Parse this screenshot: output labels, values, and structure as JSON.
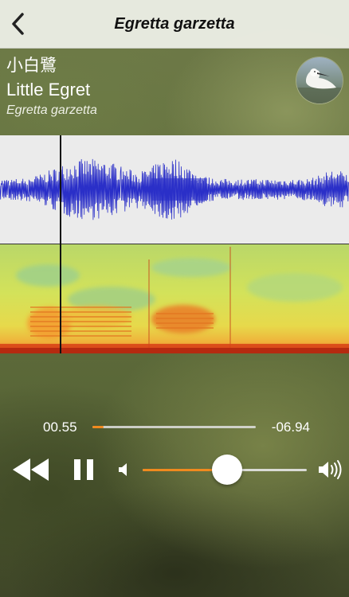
{
  "navbar": {
    "title": "Egretta garzetta",
    "back_icon": "chevron-left-icon"
  },
  "species": {
    "chinese_name": "小白鷺",
    "common_name": "Little Egret",
    "latin_name": "Egretta garzetta",
    "avatar_icon": "egret-photo"
  },
  "player": {
    "elapsed": "00.55",
    "remaining": "-06.94",
    "progress": 0.07,
    "volume": 0.5,
    "playhead": 0.172,
    "state": "playing",
    "icons": {
      "rewind": "rewind-icon",
      "pause": "pause-icon",
      "volume_low": "volume-low-icon",
      "volume_high": "volume-high-icon"
    }
  },
  "colors": {
    "accent": "#f08a1e",
    "waveform": "#2a2fc8",
    "navbar_bg": "#eef0e8"
  }
}
